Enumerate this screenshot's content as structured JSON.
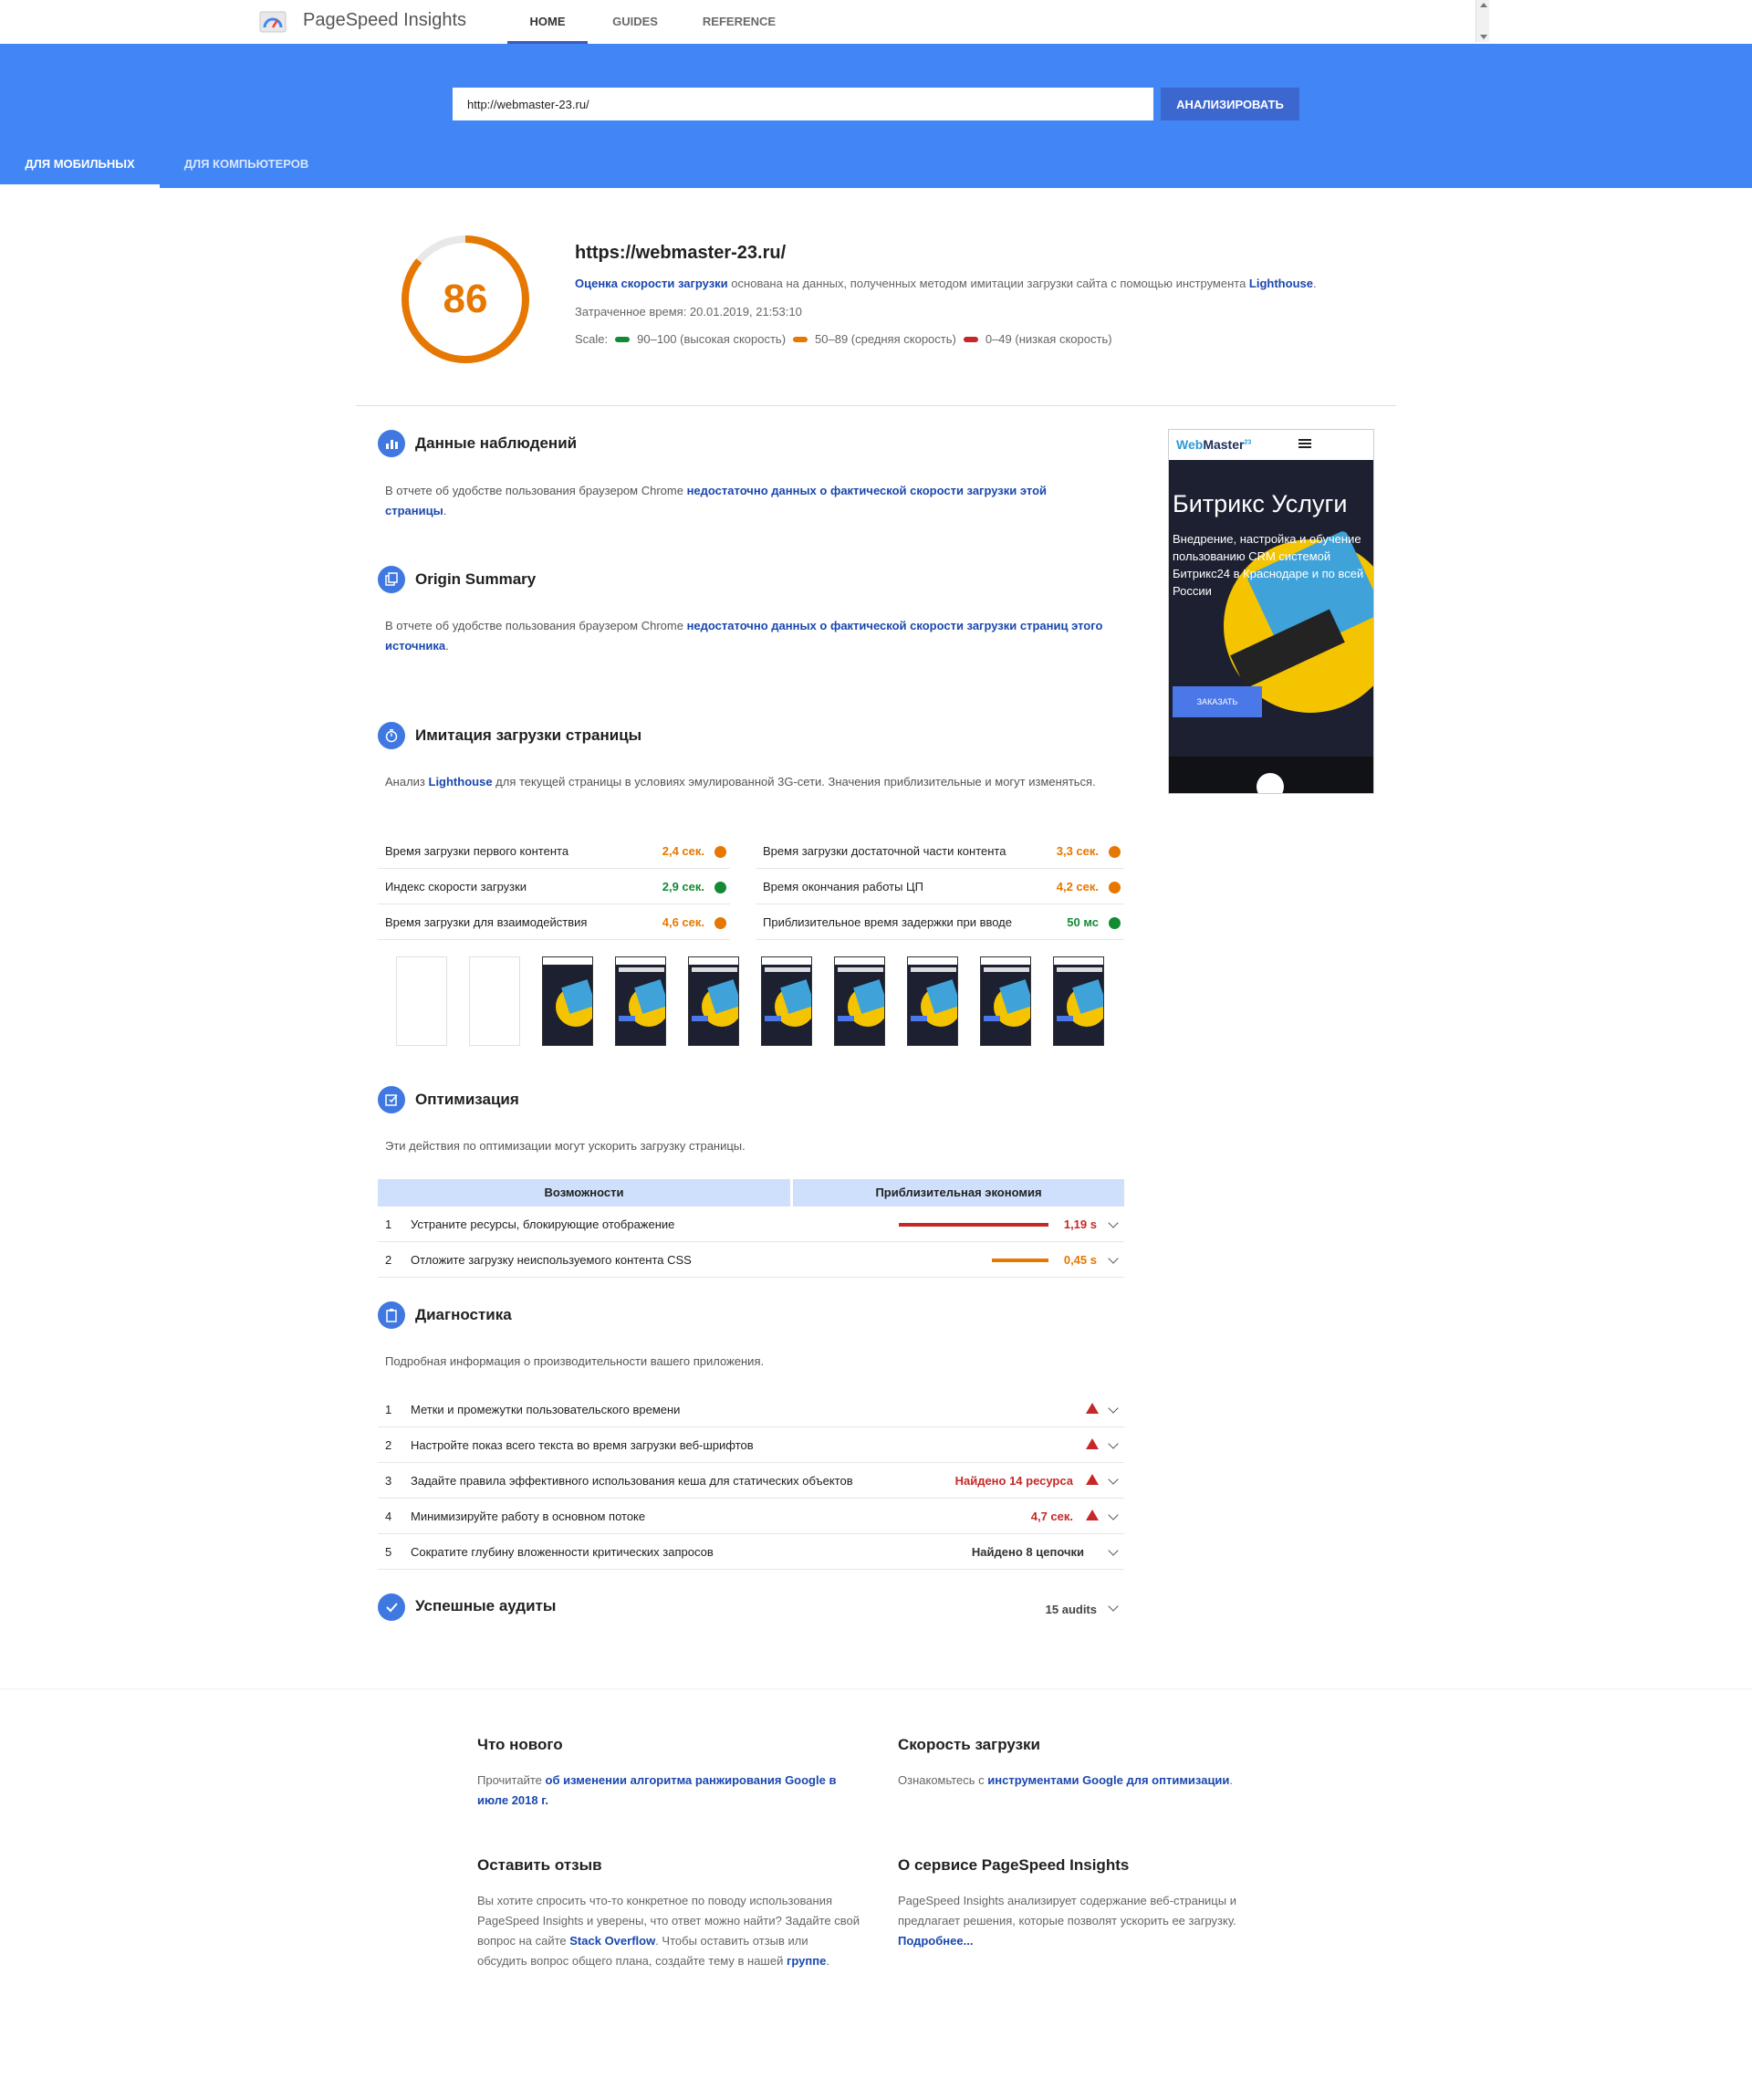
{
  "app": {
    "title": "PageSpeed Insights"
  },
  "nav": {
    "home": "HOME",
    "guides": "GUIDES",
    "reference": "REFERENCE"
  },
  "search": {
    "url_value": "http://webmaster-23.ru/",
    "analyze_label": "АНАЛИЗИРОВАТЬ"
  },
  "device_tabs": {
    "mobile": "ДЛЯ МОБИЛЬНЫХ",
    "desktop": "ДЛЯ КОМПЬЮТЕРОВ"
  },
  "score": {
    "value": "86",
    "fraction": 0.86,
    "url": "https://webmaster-23.ru/",
    "desc_link1": "Оценка скорости загрузки",
    "desc_mid": " основана на данных, полученных методом имитации загрузки сайта с помощью инструмента ",
    "desc_link2": "Lighthouse",
    "desc_end": ".",
    "time": "Затраченное время: 20.01.2019, 21:53:10",
    "scale_label": "Scale:",
    "scale_fast": "90–100 (высокая скорость)",
    "scale_avg": "50–89 (средняя скорость)",
    "scale_slow": "0–49 (низкая скорость)"
  },
  "colors": {
    "accent": "#4285f4",
    "orange": "#e67700",
    "green": "#138a34",
    "red": "#c62828"
  },
  "field_data": {
    "title": "Данные наблюдений",
    "text": "В отчете об удобстве пользования браузером Chrome ",
    "link": "недостаточно данных о фактической скорости загрузки этой страницы",
    "end": "."
  },
  "origin_summary": {
    "title": "Origin Summary",
    "text": "В отчете об удобстве пользования браузером Chrome ",
    "link": "недостаточно данных о фактической скорости загрузки страниц этого источника",
    "end": "."
  },
  "lab_data": {
    "title": "Имитация загрузки страницы",
    "text1": "Анализ ",
    "link": "Lighthouse",
    "text2": " для текущей страницы в условиях эмулированной 3G-сети. Значения приблизительные и могут изменяться.",
    "metrics_left": [
      {
        "label": "Время загрузки первого контента",
        "value": "2,4 сек."
      },
      {
        "label": "Индекс скорости загрузки",
        "value": "2,9 сек."
      },
      {
        "label": "Время загрузки для взаимодействия",
        "value": "4,6 сек."
      }
    ],
    "metrics_right": [
      {
        "label": "Время загрузки достаточной части контента",
        "value": "3,3 сек."
      },
      {
        "label": "Время окончания работы ЦП",
        "value": "4,2 сек."
      },
      {
        "label": "Приблизительное время задержки при вводе",
        "value": "50 мс"
      }
    ]
  },
  "opportunities": {
    "title": "Оптимизация",
    "text": "Эти действия по оптимизации могут ускорить загрузку страницы.",
    "col1": "Возможности",
    "col2": "Приблизительная экономия",
    "rows": [
      {
        "num": "1",
        "label": "Устраните ресурсы, блокирующие отображение",
        "value": "1,19 s"
      },
      {
        "num": "2",
        "label": "Отложите загрузку неиспользуемого контента CSS",
        "value": "0,45 s"
      }
    ]
  },
  "diagnostics": {
    "title": "Диагностика",
    "text": "Подробная информация о производительности вашего приложения.",
    "rows": [
      {
        "num": "1",
        "label": "Метки и промежутки пользовательского времени",
        "value": ""
      },
      {
        "num": "2",
        "label": "Настройте показ всего текста во время загрузки веб-шрифтов",
        "value": ""
      },
      {
        "num": "3",
        "label": "Задайте правила эффективного использования кеша для статических объектов",
        "value": "Найдено 14 ресурса"
      },
      {
        "num": "4",
        "label": "Минимизируйте работу в основном потоке",
        "value": "4,7 сек."
      },
      {
        "num": "5",
        "label": "Сократите глубину вложенности критических запросов",
        "value": "Найдено 8 цепочки"
      }
    ]
  },
  "passed": {
    "title": "Успешные аудиты",
    "count": "15 audits"
  },
  "phone": {
    "logo_a": "Web",
    "logo_b": "Master",
    "logo_sup": "23",
    "title": "Битрикс Услуги",
    "subtitle": "Внедрение, настройка и обучение пользованию CRM системой Битрикс24 в Краснодаре и по всей России",
    "button": "ЗАКАЗАТЬ"
  },
  "footer": {
    "news_title": "Что нового",
    "news_text": "Прочитайте ",
    "news_link": "об изменении алгоритма ранжирования Google в июле 2018 г.",
    "speed_title": "Скорость загрузки",
    "speed_text": "Ознакомьтесь с ",
    "speed_link": "инструментами Google для оптимизации",
    "speed_end": ".",
    "feedback_title": "Оставить отзыв",
    "feedback_text1": "Вы хотите спросить что-то конкретное по поводу использования PageSpeed Insights и уверены, что ответ можно найти? Задайте свой вопрос на сайте ",
    "feedback_link1": "Stack Overflow",
    "feedback_text2": ". Чтобы оставить отзыв или обсудить вопрос общего плана, создайте тему в нашей ",
    "feedback_link2": "группе",
    "feedback_end": ".",
    "about_title": "О сервисе PageSpeed Insights",
    "about_text": "PageSpeed Insights анализирует содержание веб-страницы и предлагает решения, которые позволят ускорить ее загрузку. ",
    "about_link": "Подробнее..."
  }
}
